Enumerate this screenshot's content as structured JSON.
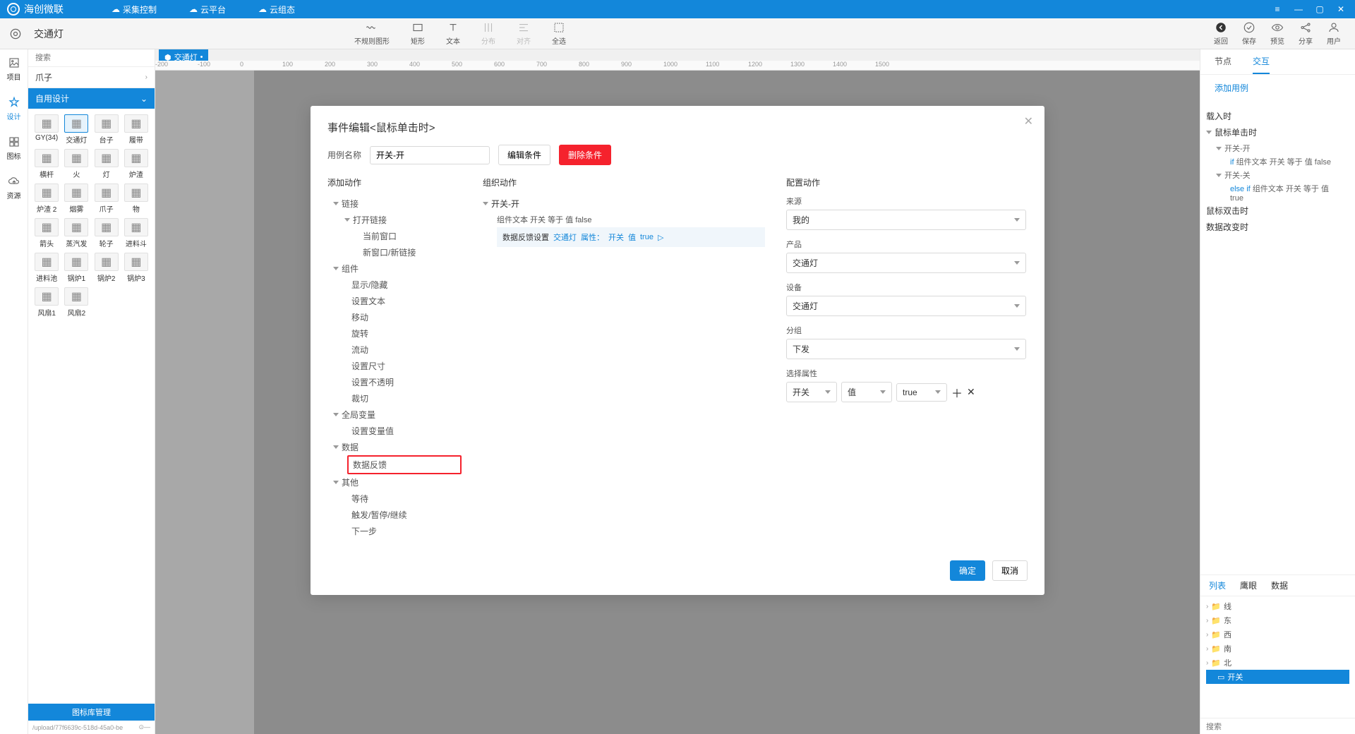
{
  "app": {
    "name": "海创微联"
  },
  "topbar": {
    "tabs": [
      {
        "label": "采集控制"
      },
      {
        "label": "云平台"
      },
      {
        "label": "云组态"
      }
    ]
  },
  "secondbar": {
    "title": "交通灯",
    "tools": [
      {
        "label": "不规则图形"
      },
      {
        "label": "矩形"
      },
      {
        "label": "文本"
      },
      {
        "label": "分布"
      },
      {
        "label": "对齐"
      },
      {
        "label": "全选"
      }
    ],
    "right": [
      {
        "label": "返回"
      },
      {
        "label": "保存"
      },
      {
        "label": "预览"
      },
      {
        "label": "分享"
      },
      {
        "label": "用户"
      }
    ]
  },
  "leftbar": [
    {
      "label": "项目"
    },
    {
      "label": "设计"
    },
    {
      "label": "图标"
    },
    {
      "label": "资源"
    }
  ],
  "panel": {
    "search_placeholder": "搜索",
    "crumb": "爪子",
    "dropdown": "自用设计",
    "palette": [
      {
        "label": "GY(34)"
      },
      {
        "label": "交通灯"
      },
      {
        "label": "台子"
      },
      {
        "label": "履带"
      },
      {
        "label": "横杆"
      },
      {
        "label": "火"
      },
      {
        "label": "灯"
      },
      {
        "label": "炉渣"
      },
      {
        "label": "炉渣 2"
      },
      {
        "label": "烟雾"
      },
      {
        "label": "爪子"
      },
      {
        "label": "物"
      },
      {
        "label": "箭头"
      },
      {
        "label": "蒸汽发"
      },
      {
        "label": "轮子"
      },
      {
        "label": "进料斗"
      },
      {
        "label": "进料池"
      },
      {
        "label": "锅炉1"
      },
      {
        "label": "锅炉2"
      },
      {
        "label": "锅炉3"
      },
      {
        "label": "风扇1"
      },
      {
        "label": "风扇2"
      }
    ],
    "footer_btn": "图标库管理",
    "footer_path": "/upload/77f6639c-518d-45a0-be"
  },
  "canvas": {
    "tab": "交通灯",
    "ruler": [
      -200,
      -100,
      0,
      100,
      200,
      300,
      400,
      500,
      600,
      700,
      800,
      900,
      1000,
      1100,
      1200,
      1300,
      1400,
      1500
    ]
  },
  "rightpanel": {
    "tabs": [
      {
        "label": "节点"
      },
      {
        "label": "交互"
      }
    ],
    "add_case": "添加用例",
    "events": {
      "load": "载入时",
      "click": "鼠标单击时",
      "click_cases": [
        {
          "name": "开关-开",
          "cond_pre": "if",
          "cond_text": "组件文本 开关 等于 值 false"
        },
        {
          "name": "开关-关",
          "cond_pre": "else if",
          "cond_text": "组件文本 开关 等于 值 true"
        }
      ],
      "dblclick": "鼠标双击时",
      "datachange": "数据改变时"
    },
    "lower_tabs": [
      {
        "label": "列表"
      },
      {
        "label": "鹰眼"
      },
      {
        "label": "数据"
      }
    ],
    "list": [
      {
        "label": "线"
      },
      {
        "label": "东"
      },
      {
        "label": "西"
      },
      {
        "label": "南"
      },
      {
        "label": "北"
      },
      {
        "label": "开关"
      }
    ],
    "search_placeholder": "搜索"
  },
  "modal": {
    "title_prefix": "事件编辑",
    "title_event": "<鼠标单击时>",
    "name_label": "用例名称",
    "name_value": "开关-开",
    "edit_cond": "编辑条件",
    "del_cond": "删除条件",
    "col1_h": "添加动作",
    "col2_h": "组织动作",
    "col3_h": "配置动作",
    "actions": {
      "link": "链接",
      "open_link": "打开链接",
      "cur_win": "当前窗口",
      "new_win": "新窗口/新链接",
      "comp": "组件",
      "show_hide": "显示/隐藏",
      "set_text": "设置文本",
      "move": "移动",
      "rotate": "旋转",
      "flow": "流动",
      "size": "设置尺寸",
      "opacity": "设置不透明",
      "crop": "裁切",
      "global": "全局变量",
      "set_var": "设置变量值",
      "data": "数据",
      "feedback": "数据反馈",
      "other": "其他",
      "wait": "等待",
      "trigger": "触发/暂停/继续",
      "next": "下一步"
    },
    "org": {
      "root": "开关-开",
      "cond": "组件文本 开关 等于 值 false",
      "action_label": "数据反馈设置",
      "action_target": "交通灯",
      "action_prop": "属性：",
      "action_key": "开关",
      "action_val_label": "值",
      "action_val": "true"
    },
    "cfg": {
      "source_label": "来源",
      "source_val": "我的",
      "product_label": "产品",
      "product_val": "交通灯",
      "device_label": "设备",
      "device_val": "交通灯",
      "group_label": "分组",
      "group_val": "下发",
      "attr_label": "选择属性",
      "attr_key": "开关",
      "attr_unit": "值",
      "attr_val": "true"
    },
    "ok": "确定",
    "cancel": "取消"
  }
}
